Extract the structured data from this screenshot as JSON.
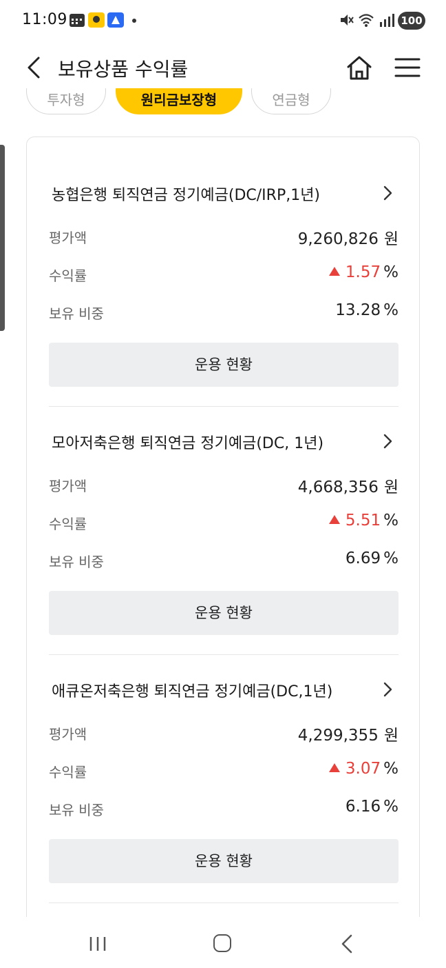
{
  "status_bar": {
    "time": "11:09",
    "battery": "100",
    "notification_icons": [
      "calendar-icon",
      "app-icon-yellow",
      "app-icon-blue"
    ],
    "system_icons": [
      "mute-icon",
      "wifi-icon",
      "signal-icon"
    ]
  },
  "header": {
    "title": "보유상품 수익률",
    "back_icon": "chevron-left-icon",
    "home_icon": "home-icon",
    "menu_icon": "hamburger-menu-icon"
  },
  "tabs": [
    {
      "label": "투자형",
      "active": false
    },
    {
      "label": "원리금보장형",
      "active": true
    },
    {
      "label": "연금형",
      "active": false
    }
  ],
  "labels": {
    "valuation": "평가액",
    "rate": "수익률",
    "weight": "보유 비중",
    "won": "원",
    "percent": "%",
    "operation_button": "운용 현황"
  },
  "products": [
    {
      "name": "농협은행 퇴직연금 정기예금(DC/IRP,1년)",
      "valuation": "9,260,826",
      "rate": "1.57",
      "weight": "13.28"
    },
    {
      "name": "모아저축은행 퇴직연금 정기예금(DC, 1년)",
      "valuation": "4,668,356",
      "rate": "5.51",
      "weight": "6.69"
    },
    {
      "name": "애큐온저축은행 퇴직연금 정기예금(DC,1년)",
      "valuation": "4,299,355",
      "rate": "3.07",
      "weight": "6.16"
    }
  ],
  "colors": {
    "accent": "#ffc700",
    "up": "#e8403a",
    "button_bg": "#eceef0"
  }
}
